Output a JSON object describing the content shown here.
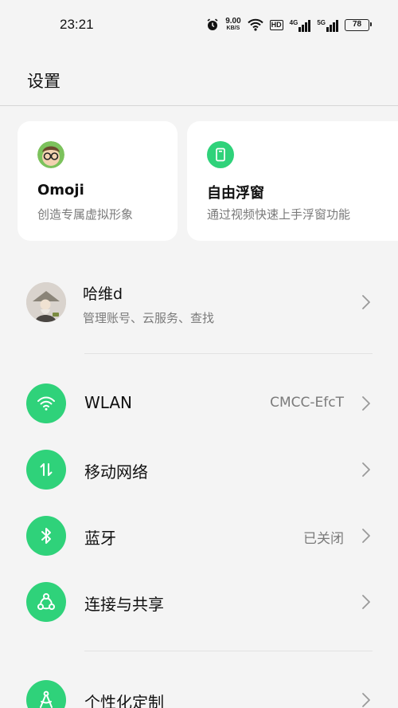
{
  "status_bar": {
    "time": "23:21",
    "net_speed_value": "9.00",
    "net_speed_unit": "KB/S",
    "hd_label": "HD",
    "network1_tag": "4G",
    "network2_tag": "5G",
    "battery": "78",
    "icons": [
      "alarm-icon",
      "wifi-icon",
      "signal-icon",
      "battery-icon"
    ]
  },
  "header": {
    "title": "设置"
  },
  "cards": [
    {
      "title": "Omoji",
      "subtitle": "创造专属虚拟形象",
      "icon": "omoji-avatar-icon"
    },
    {
      "title": "自由浮窗",
      "subtitle": "通过视频快速上手浮窗功能",
      "icon": "floating-window-icon"
    }
  ],
  "account": {
    "name": "哈维d",
    "subtitle": "管理账号、云服务、查找"
  },
  "settings": [
    {
      "label": "WLAN",
      "value": "CMCC-EfcT",
      "icon": "wifi-icon"
    },
    {
      "label": "移动网络",
      "value": "",
      "icon": "mobile-data-icon"
    },
    {
      "label": "蓝牙",
      "value": "已关闭",
      "icon": "bluetooth-icon"
    },
    {
      "label": "连接与共享",
      "value": "",
      "icon": "share-icon"
    },
    {
      "label": "个性化定制",
      "value": "",
      "icon": "personalize-icon"
    }
  ],
  "colors": {
    "accent": "#2fd27a",
    "background": "#f4f4f4",
    "card": "#ffffff",
    "secondary_text": "#7a7a7a"
  }
}
